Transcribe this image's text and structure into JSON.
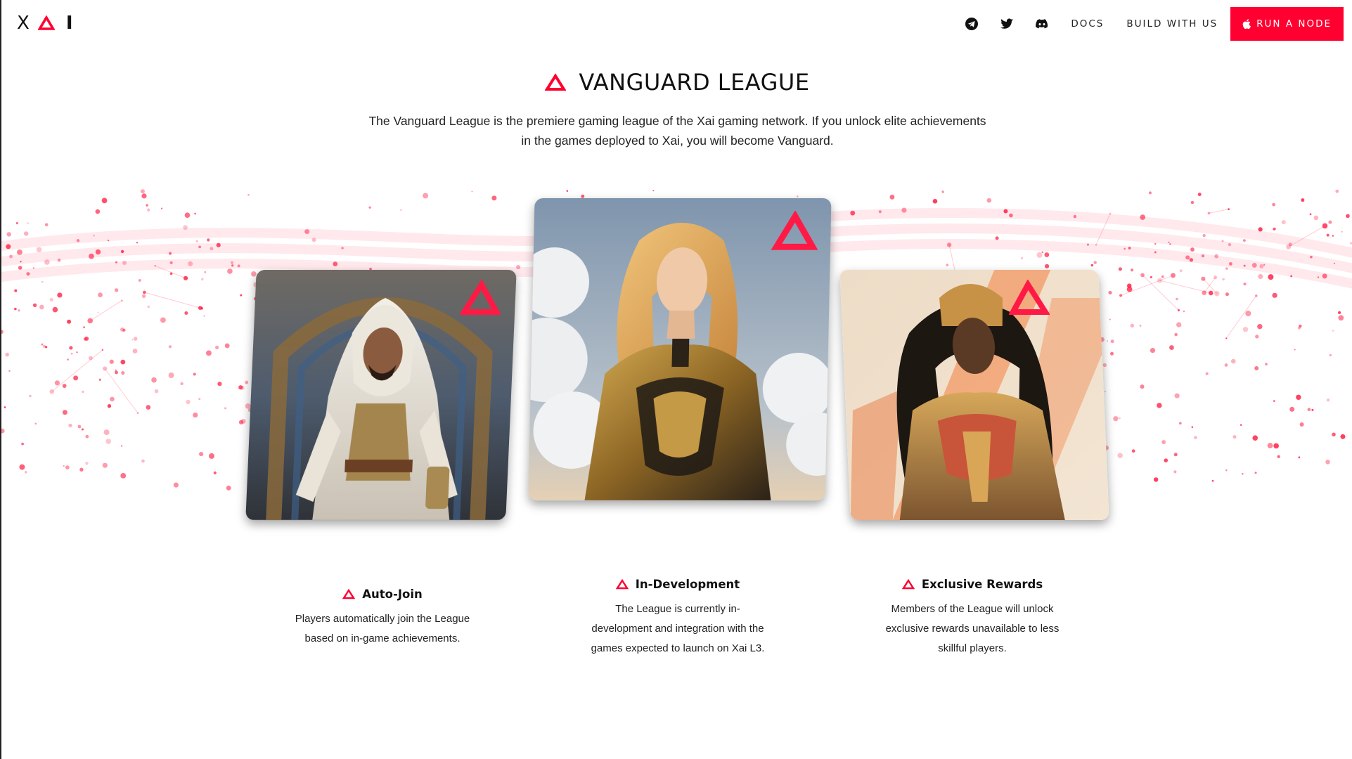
{
  "header": {
    "logo_letters": [
      "X",
      "I"
    ],
    "social_icons": [
      "telegram-icon",
      "twitter-icon",
      "discord-icon"
    ],
    "nav_links": [
      "DOCS",
      "BUILD WITH US"
    ],
    "cta_label": "RUN A NODE",
    "cta_icon": "apple-icon"
  },
  "colors": {
    "accent": "#ff0030",
    "text": "#111111",
    "background": "#ffffff"
  },
  "hero": {
    "title": "VANGUARD LEAGUE",
    "intro": "The Vanguard League is the premiere gaming league of the Xai gaming network. If you unlock elite achievements in the games deployed to Xai, you will become Vanguard."
  },
  "cards": [
    {
      "subject": "hooded-warrior-portrait",
      "badge_icon": "triangle-logo-icon"
    },
    {
      "subject": "armored-blonde-heroine-portrait",
      "badge_icon": "triangle-logo-icon"
    },
    {
      "subject": "golden-warrior-queen-portrait",
      "badge_icon": "triangle-logo-icon"
    }
  ],
  "features": [
    {
      "title": "Auto-Join",
      "text": "Players automatically join the League based on in-game achievements."
    },
    {
      "title": "In-Development",
      "text": "The League is currently in-development and integration with the games expected to launch on Xai L3."
    },
    {
      "title": "Exclusive Rewards",
      "text": "Members of the League will unlock exclusive rewards unavailable to less skillful players."
    }
  ]
}
